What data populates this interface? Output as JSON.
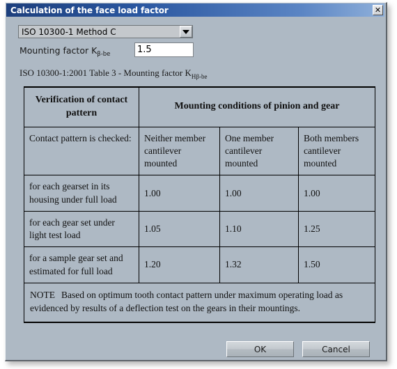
{
  "window": {
    "title": "Calculation of the face load factor",
    "close_icon": "close-icon",
    "close_glyph": "✕"
  },
  "form": {
    "method_select": {
      "selected": "ISO 10300-1 Method C",
      "arrow_icon": "chevron-down-icon"
    },
    "mounting_factor": {
      "label_main": "Mounting factor K",
      "label_sub": "β-be",
      "value": "1.5",
      "placeholder": ""
    }
  },
  "table": {
    "caption_main": "ISO 10300-1:2001 Table 3 - Mounting factor K",
    "caption_sub": "Hβ-be",
    "header_top": {
      "col1": "Verification of contact pattern",
      "col_span": "Mounting conditions of pinion and gear"
    },
    "header_sub": [
      "Contact pattern is checked:",
      "Neither member cantilever mounted",
      "One member cantilever mounted",
      "Both members cantilever mounted"
    ],
    "rows": [
      {
        "criterion": "for each gearset in its housing under full load",
        "values": [
          "1.00",
          "1.00",
          "1.00"
        ]
      },
      {
        "criterion": "for each gear set under light test load",
        "values": [
          "1.05",
          "1.10",
          "1.25"
        ]
      },
      {
        "criterion": "for a sample gear set and estimated for full load",
        "values": [
          "1.20",
          "1.32",
          "1.50"
        ]
      }
    ],
    "note": {
      "label": "NOTE",
      "text": "Based on optimum tooth contact pattern under maximum operating load as evidenced by results of a deflection test on the gears in their mountings."
    }
  },
  "buttons": {
    "ok": "OK",
    "cancel": "Cancel"
  },
  "colors": {
    "dialog_background": "#aeb9c4",
    "titlebar_start": "#1d3f7d",
    "titlebar_end": "#8fb0da",
    "title_text": "#ffffff",
    "field_background": "#ffffff",
    "table_border": "#000000"
  }
}
